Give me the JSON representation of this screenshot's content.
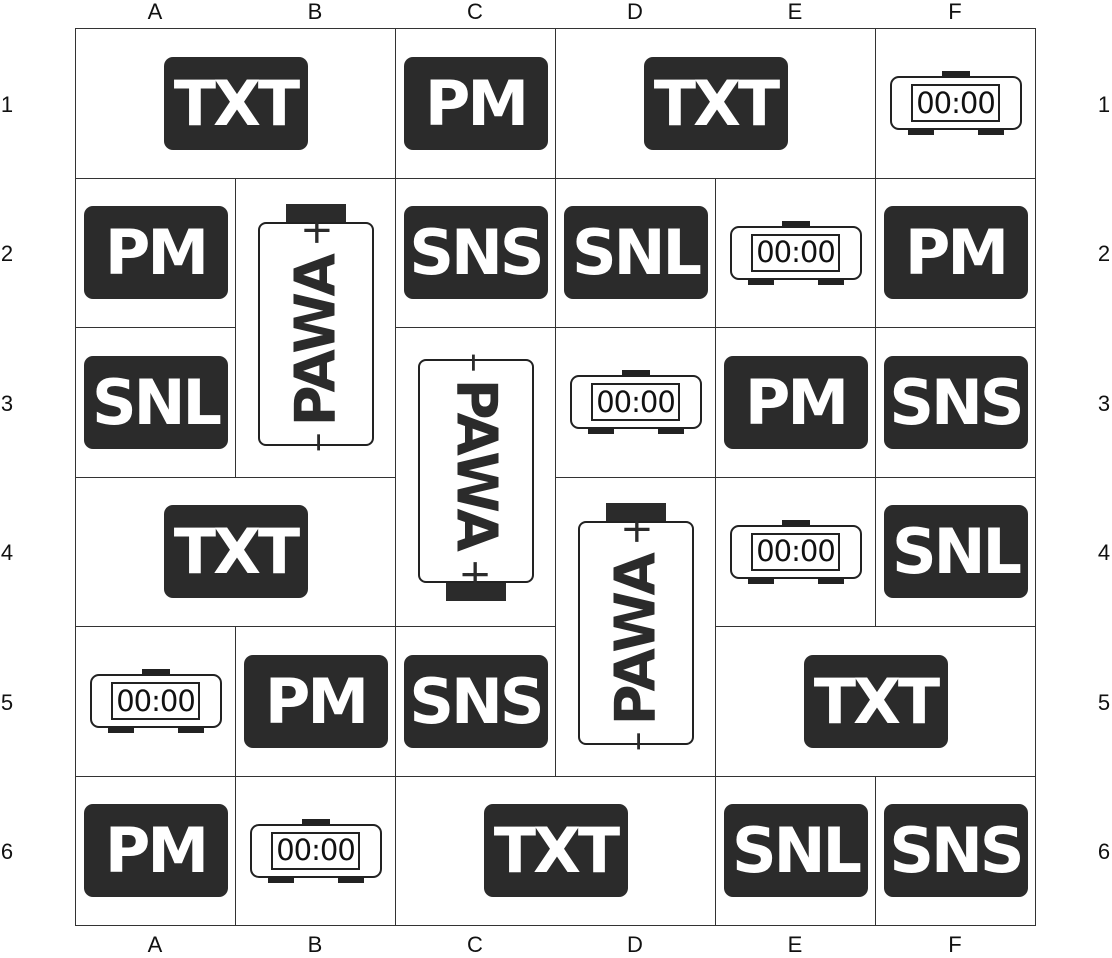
{
  "columns": [
    "A",
    "B",
    "C",
    "D",
    "E",
    "F"
  ],
  "rows": [
    "1",
    "2",
    "3",
    "4",
    "5",
    "6"
  ],
  "piece_types": {
    "txt": "TXT",
    "pm": "PM",
    "sns": "SNS",
    "snl": "SNL",
    "clock": "00:00",
    "battery": "PAWA",
    "battery_plus": "+",
    "battery_minus": "–"
  },
  "pieces": [
    {
      "type": "txt",
      "col": 0,
      "row": 0,
      "w": 2,
      "h": 1
    },
    {
      "type": "pm",
      "col": 2,
      "row": 0,
      "w": 1,
      "h": 1
    },
    {
      "type": "txt",
      "col": 3,
      "row": 0,
      "w": 2,
      "h": 1
    },
    {
      "type": "clock",
      "col": 5,
      "row": 0,
      "w": 1,
      "h": 1
    },
    {
      "type": "pm",
      "col": 0,
      "row": 1,
      "w": 1,
      "h": 1
    },
    {
      "type": "battery",
      "dir": "up",
      "col": 1,
      "row": 1,
      "w": 1,
      "h": 2
    },
    {
      "type": "sns",
      "col": 2,
      "row": 1,
      "w": 1,
      "h": 1
    },
    {
      "type": "snl",
      "col": 3,
      "row": 1,
      "w": 1,
      "h": 1
    },
    {
      "type": "clock",
      "col": 4,
      "row": 1,
      "w": 1,
      "h": 1
    },
    {
      "type": "pm",
      "col": 5,
      "row": 1,
      "w": 1,
      "h": 1
    },
    {
      "type": "snl",
      "col": 0,
      "row": 2,
      "w": 1,
      "h": 1
    },
    {
      "type": "battery",
      "dir": "down",
      "col": 2,
      "row": 2,
      "w": 1,
      "h": 2
    },
    {
      "type": "clock",
      "col": 3,
      "row": 2,
      "w": 1,
      "h": 1
    },
    {
      "type": "pm",
      "col": 4,
      "row": 2,
      "w": 1,
      "h": 1
    },
    {
      "type": "sns",
      "col": 5,
      "row": 2,
      "w": 1,
      "h": 1
    },
    {
      "type": "txt",
      "col": 0,
      "row": 3,
      "w": 2,
      "h": 1
    },
    {
      "type": "battery",
      "dir": "up",
      "col": 3,
      "row": 3,
      "w": 1,
      "h": 2
    },
    {
      "type": "clock",
      "col": 4,
      "row": 3,
      "w": 1,
      "h": 1
    },
    {
      "type": "snl",
      "col": 5,
      "row": 3,
      "w": 1,
      "h": 1
    },
    {
      "type": "clock",
      "col": 0,
      "row": 4,
      "w": 1,
      "h": 1
    },
    {
      "type": "pm",
      "col": 1,
      "row": 4,
      "w": 1,
      "h": 1
    },
    {
      "type": "sns",
      "col": 2,
      "row": 4,
      "w": 1,
      "h": 1
    },
    {
      "type": "txt",
      "col": 4,
      "row": 4,
      "w": 2,
      "h": 1
    },
    {
      "type": "pm",
      "col": 0,
      "row": 5,
      "w": 1,
      "h": 1
    },
    {
      "type": "clock",
      "col": 1,
      "row": 5,
      "w": 1,
      "h": 1
    },
    {
      "type": "txt",
      "col": 2,
      "row": 5,
      "w": 2,
      "h": 1
    },
    {
      "type": "snl",
      "col": 4,
      "row": 5,
      "w": 1,
      "h": 1
    },
    {
      "type": "sns",
      "col": 5,
      "row": 5,
      "w": 1,
      "h": 1
    }
  ]
}
